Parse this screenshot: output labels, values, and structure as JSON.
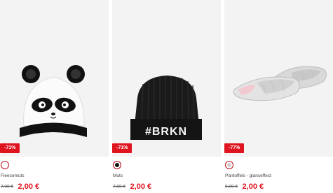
{
  "products": [
    {
      "icon": "panda-hat-image",
      "discount": "-71%",
      "swatch_color": "#ffffff",
      "name": "Fleecemuts",
      "old_price": "7,00 €",
      "price": "2,00 €"
    },
    {
      "icon": "beanie-image",
      "discount": "-71%",
      "swatch_color": "#111111",
      "name": "Muts",
      "old_price": "7,00 €",
      "price": "2,00 €",
      "beanie_text": "#BRKN"
    },
    {
      "icon": "slippers-image",
      "discount": "-77%",
      "swatch_color": "#cfcfcf",
      "name": "Pantoffels - glanseffect",
      "old_price": "9,00 €",
      "price": "2,00 €"
    }
  ],
  "colors": {
    "accent": "#e0141e",
    "tile_background": "#f3f3f3"
  }
}
